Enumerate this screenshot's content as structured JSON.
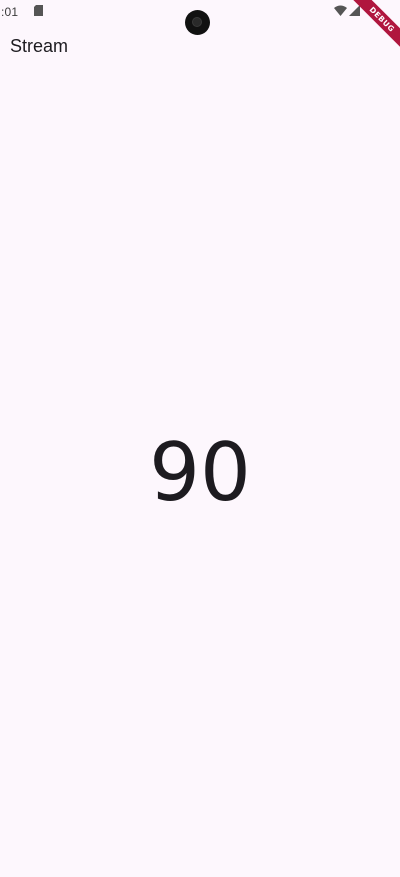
{
  "status_bar": {
    "time": ":01",
    "icons": [
      "sd-card-icon",
      "wifi-icon",
      "signal-icon"
    ]
  },
  "debug_banner": {
    "label": "DEBUG",
    "color": "#b0163e"
  },
  "app_bar": {
    "title": "Stream"
  },
  "main": {
    "value": "90"
  },
  "colors": {
    "background": "#fdf7fd",
    "text": "#1d1b20"
  }
}
